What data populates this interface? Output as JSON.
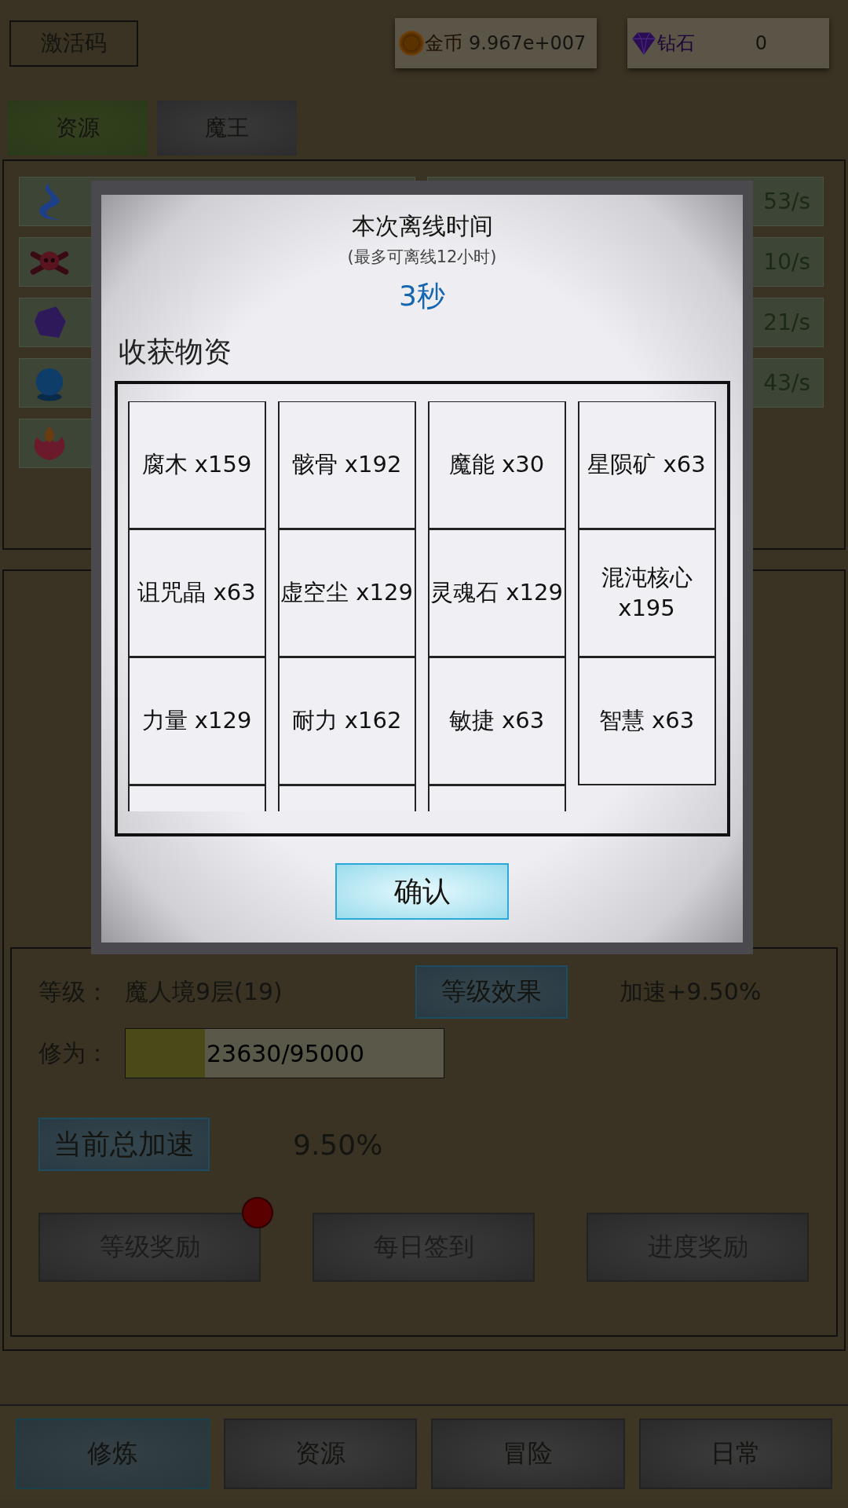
{
  "top_bar": {
    "activation_button": "激活码",
    "gold": {
      "label": "金币",
      "value": "9.967e+007"
    },
    "diamond": {
      "label": "钻石",
      "value": "0"
    }
  },
  "tabs": [
    {
      "label": "资源",
      "selected": true
    },
    {
      "label": "魔王",
      "selected": false
    }
  ],
  "resources": [
    {
      "kind": "flame",
      "rate": "53/s"
    },
    {
      "kind": "skull",
      "rate": "10/s"
    },
    {
      "kind": "crystal",
      "rate": "21/s"
    },
    {
      "kind": "orb",
      "rate": "43/s"
    },
    {
      "kind": "flower"
    }
  ],
  "level": {
    "label": "等级：",
    "value": "魔人境9层(19)",
    "effect_button": "等级效果",
    "bonus": "加速+9.50%",
    "progress_label": "修为：",
    "progress": {
      "level": 0.25,
      "text": "23630/95000"
    },
    "total_button": "当前总加速",
    "total_value": "9.50%"
  },
  "reward_buttons": [
    {
      "label": "等级奖励",
      "badge": true
    },
    {
      "label": "每日签到",
      "badge": false
    },
    {
      "label": "进度奖励",
      "badge": false
    }
  ],
  "bottom_nav": [
    {
      "label": "修炼",
      "selected": true
    },
    {
      "label": "资源",
      "selected": false
    },
    {
      "label": "冒险",
      "selected": false
    },
    {
      "label": "日常",
      "selected": false
    }
  ],
  "dialog": {
    "title": "本次离线时间",
    "subtitle": "(最多可离线12小时)",
    "duration": "3秒",
    "section": "收获物资",
    "items": [
      "腐木 x159",
      "骸骨 x192",
      "魔能 x30",
      "星陨矿 x63",
      "诅咒晶 x63",
      "虚空尘 x129",
      "灵魂石 x129",
      "混沌核心 x195",
      "力量 x129",
      "耐力 x162",
      "敏捷 x63",
      "智慧 x63"
    ],
    "confirm": "确认"
  }
}
